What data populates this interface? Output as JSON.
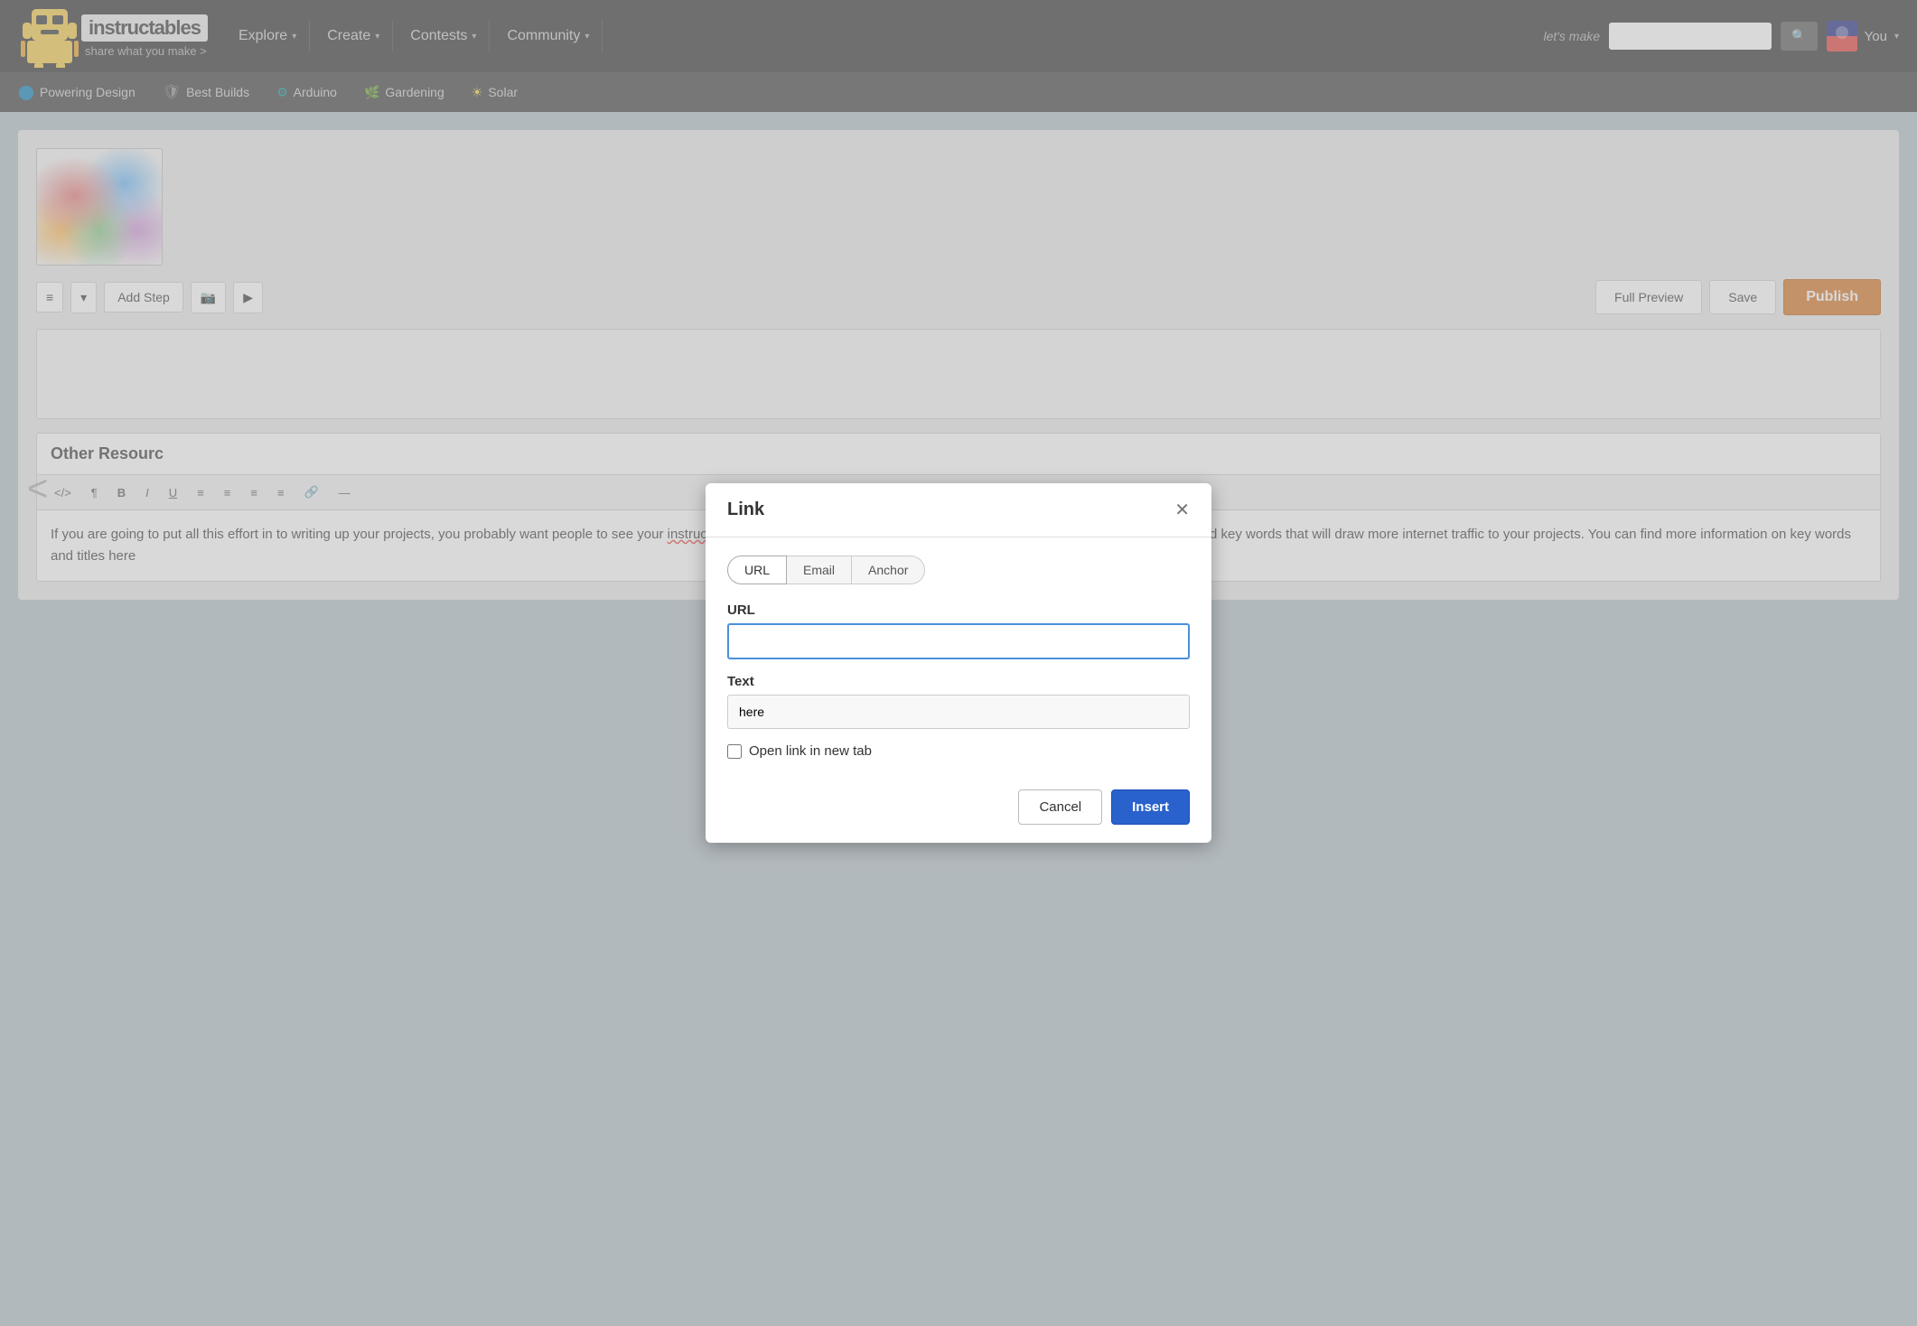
{
  "header": {
    "logo_name": "instructables",
    "logo_tagline": "share what you make >",
    "nav": [
      {
        "label": "Explore",
        "arrow": "▾"
      },
      {
        "label": "Create",
        "arrow": "▾"
      },
      {
        "label": "Contests",
        "arrow": "▾"
      },
      {
        "label": "Community",
        "arrow": "▾"
      }
    ],
    "search_placeholder": "let's make",
    "user_label": "You",
    "user_arrow": "▾"
  },
  "secondary_nav": [
    {
      "label": "Powering Design",
      "icon": "🔵"
    },
    {
      "label": "Best Builds",
      "icon": "🛡"
    },
    {
      "label": "Arduino",
      "icon": "⚙"
    },
    {
      "label": "Gardening",
      "icon": "🌿"
    },
    {
      "label": "Solar",
      "icon": "☀"
    }
  ],
  "toolbar": {
    "add_step": "Add Step",
    "full_preview": "Full Preview",
    "save": "Save",
    "publish": "Publish"
  },
  "other_resources": {
    "title": "Other Resourc",
    "content": "If you are going to put all this effort in to writing up your projects, you probably want people to see your instructable!  A great way to get more views on your instructables is to give it a good title and key words that will draw more internet traffic to your projects.  You can find more information on key words and titles here"
  },
  "modal": {
    "title": "Link",
    "tabs": [
      {
        "label": "URL",
        "active": true
      },
      {
        "label": "Email",
        "active": false
      },
      {
        "label": "Anchor",
        "active": false
      }
    ],
    "url_label": "URL",
    "url_placeholder": "",
    "text_label": "Text",
    "text_value": "here",
    "checkbox_label": "Open link in new tab",
    "cancel_label": "Cancel",
    "insert_label": "Insert"
  }
}
